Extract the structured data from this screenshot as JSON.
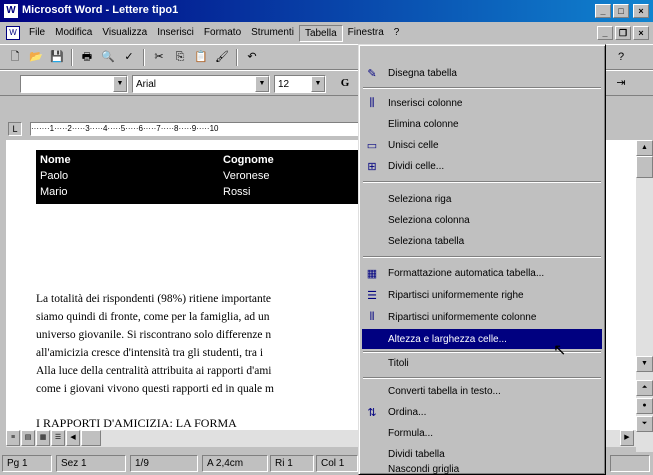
{
  "window": {
    "title": "Microsoft Word - Lettere tipo1",
    "app_icon": "word-icon"
  },
  "menubar": {
    "items": [
      "File",
      "Modifica",
      "Visualizza",
      "Inserisci",
      "Formato",
      "Strumenti",
      "Tabella",
      "Finestra",
      "?"
    ]
  },
  "toolbar_standard": {
    "icons": [
      "new-doc-icon",
      "open-folder-icon",
      "save-icon",
      "print-icon",
      "print-preview-icon",
      "spelling-icon",
      "cut-icon",
      "copy-icon",
      "paste-icon",
      "format-painter-icon",
      "undo-icon"
    ]
  },
  "toolbar_format": {
    "style_value": "",
    "font_value": "Arial",
    "size_value": "12",
    "bold_label": "G"
  },
  "document": {
    "table": {
      "headers": [
        "Nome",
        "Cognome"
      ],
      "rows": [
        [
          "Paolo",
          "Veronese"
        ],
        [
          "Mario",
          "Rossi"
        ]
      ]
    },
    "body_lines": [
      "La totalità dei rispondenti (98%) ritiene importante",
      "siamo quindi di fronte, come per la famiglia, ad un",
      "universo giovanile. Si riscontrano solo differenze n",
      "all'amicizia cresce d'intensità tra gli studenti, tra i",
      "Alla luce della centralità attribuita ai rapporti d'ami",
      "come i giovani vivono questi rapporti ed in quale m"
    ],
    "section_heading": "I RAPPORTI D'AMICIZIA: LA FORMA"
  },
  "statusbar": {
    "page": "Pg 1",
    "section": "Sez 1",
    "pages": "1/9",
    "position": "A 2,4cm",
    "line": "Ri 1",
    "column": "Col 1"
  },
  "tabella_menu": {
    "items": [
      {
        "label": "Disegna tabella",
        "icon": "pencil-icon"
      },
      {
        "label": "Inserisci colonne",
        "icon": "insert-columns-icon"
      },
      {
        "label": "Elimina colonne",
        "icon": ""
      },
      {
        "label": "Unisci celle",
        "icon": "merge-cells-icon"
      },
      {
        "label": "Dividi celle...",
        "icon": "split-cells-icon"
      },
      {
        "label": "Seleziona riga",
        "icon": ""
      },
      {
        "label": "Seleziona colonna",
        "icon": ""
      },
      {
        "label": "Seleziona tabella",
        "icon": ""
      },
      {
        "label": "Formattazione automatica tabella...",
        "icon": "autoformat-table-icon"
      },
      {
        "label": "Ripartisci uniformemente righe",
        "icon": "distribute-rows-icon"
      },
      {
        "label": "Ripartisci uniformemente colonne",
        "icon": "distribute-columns-icon"
      },
      {
        "label": "Altezza e larghezza celle...",
        "icon": ""
      },
      {
        "label": "Titoli",
        "icon": ""
      },
      {
        "label": "Converti tabella in testo...",
        "icon": ""
      },
      {
        "label": "Ordina...",
        "icon": "sort-icon"
      },
      {
        "label": "Formula...",
        "icon": ""
      },
      {
        "label": "Dividi tabella",
        "icon": ""
      },
      {
        "label": "Nascondi griglia",
        "icon": ""
      }
    ],
    "highlighted_index": 11
  }
}
